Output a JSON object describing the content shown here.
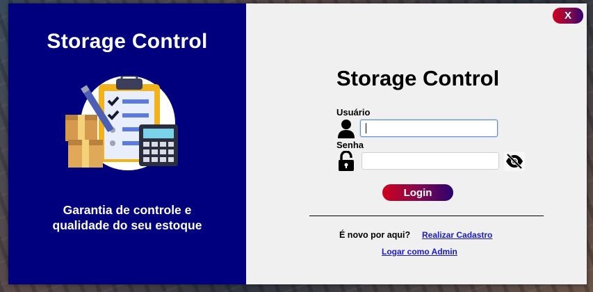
{
  "left_panel": {
    "title": "Storage Control",
    "slogan_line1": "Garantia de controle e",
    "slogan_line2": "qualidade do seu estoque"
  },
  "right_panel": {
    "close_label": "X",
    "title": "Storage Control",
    "username_label": "Usuário",
    "username_value": "",
    "password_label": "Senha",
    "password_value": "",
    "login_label": "Login",
    "signup_prompt": "É novo por aqui?",
    "signup_link": "Realizar Cadastro",
    "admin_link": "Logar como Admin"
  },
  "colors": {
    "brand_blue": "#00007f",
    "panel_bg": "#f0f0f0",
    "button_gradient_start": "#d0001e",
    "button_gradient_end": "#2a0070",
    "link": "#1a1acc"
  },
  "icons": [
    "clipboard-icon",
    "boxes-icon",
    "calculator-icon",
    "user-icon",
    "lock-icon",
    "eye-slash-icon"
  ]
}
